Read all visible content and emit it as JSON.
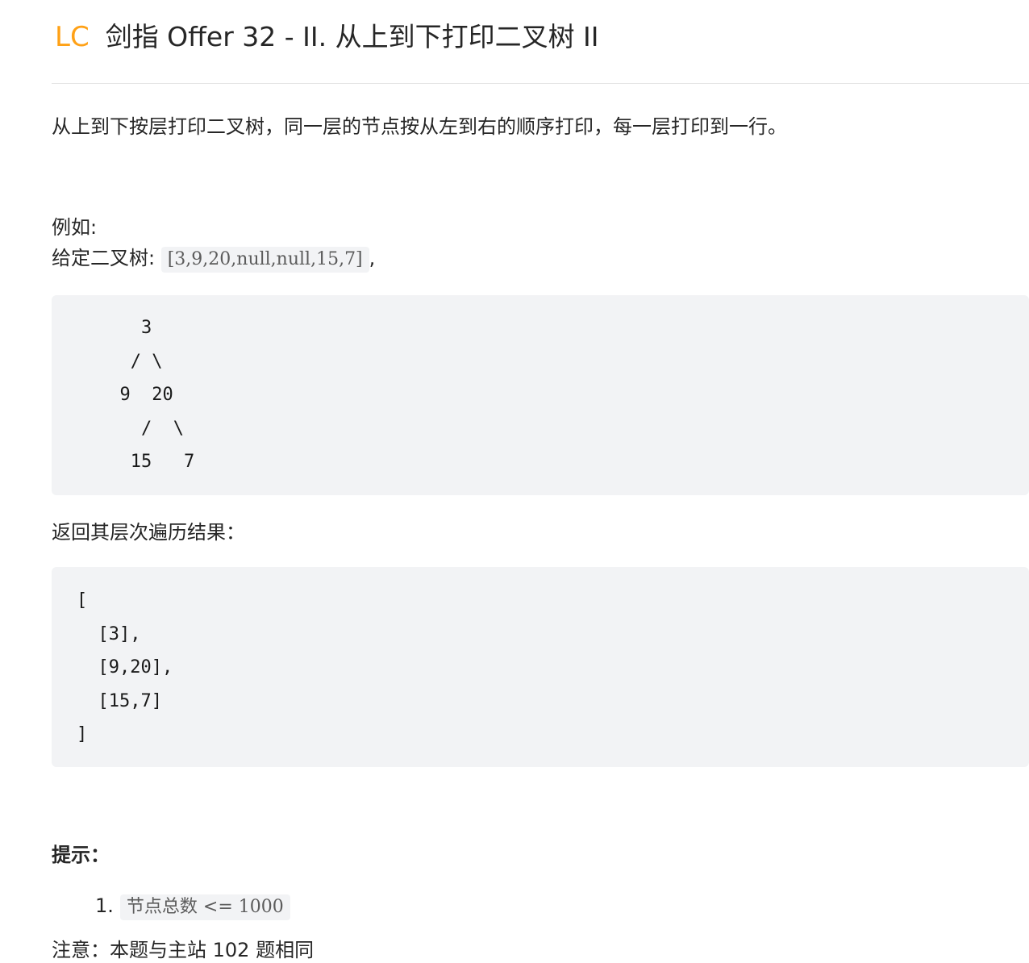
{
  "header": {
    "badge": "LC",
    "title": "剑指 Offer 32 - II. 从上到下打印二叉树 II",
    "accent_color": "#ffa116"
  },
  "description": "从上到下按层打印二叉树，同一层的节点按从左到右的顺序打印，每一层打印到一行。",
  "example": {
    "label": "例如:",
    "given_prefix": "给定二叉树: ",
    "given_code": "[3,9,20,null,null,15,7]",
    "given_suffix": ",",
    "tree_lines": [
      "    3",
      "   / \\",
      "  9  20",
      "    /  \\",
      "   15   7"
    ],
    "result_label": "返回其层次遍历结果：",
    "result_lines": [
      "[",
      "  [3],",
      "  [9,20],",
      "  [15,7]",
      "]"
    ]
  },
  "hints": {
    "heading": "提示：",
    "items": [
      {
        "number": "1.",
        "code": "节点总数 <= 1000"
      }
    ]
  },
  "note": "注意：本题与主站 102 题相同"
}
